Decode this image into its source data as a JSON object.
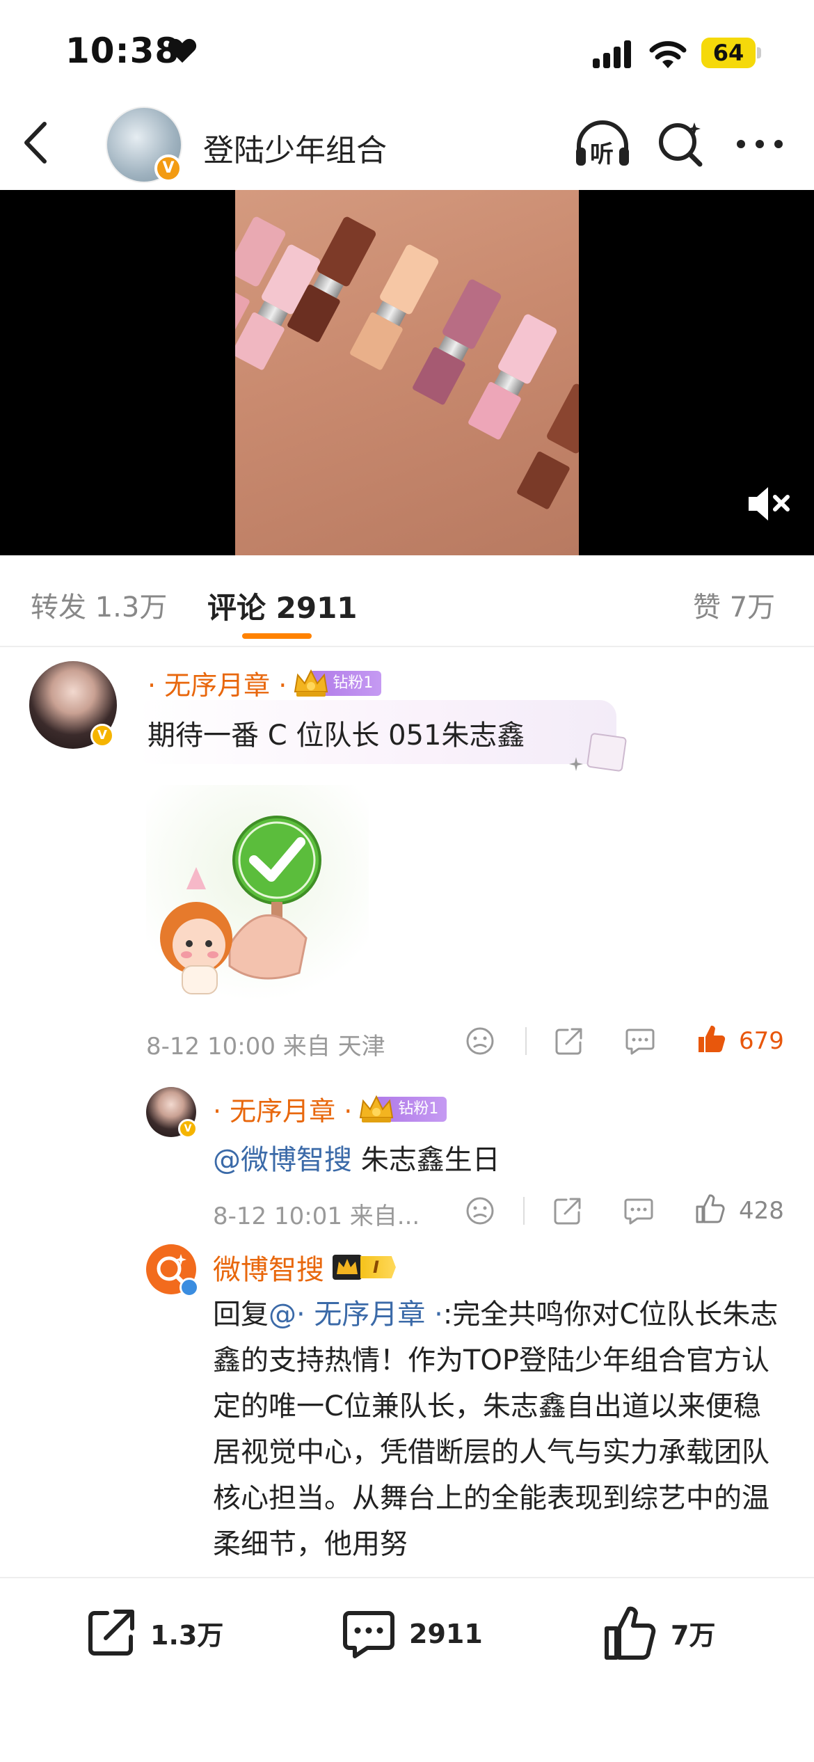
{
  "status_bar": {
    "time": "10:38",
    "battery": "64"
  },
  "header": {
    "title": "登陆少年组合",
    "listen_label": "听"
  },
  "tabs": {
    "repost": "转发 1.3万",
    "comments": "评论 2911",
    "likes": "赞 7万"
  },
  "comments": [
    {
      "name": "· 无序月章 ·",
      "fan_badge": "钻粉1",
      "text": "期待一番 C 位队长 051朱志鑫",
      "meta": "8-12 10:00 来自 天津",
      "likes": "679"
    }
  ],
  "replies": [
    {
      "name": "· 无序月章 ·",
      "fan_badge": "钻粉1",
      "mention": "@微博智搜",
      "text": " 朱志鑫生日",
      "meta": "8-12 10:01 来自...",
      "likes": "428"
    },
    {
      "name": "微博智搜",
      "level_badge": "I",
      "prefix": "回复",
      "mention": "@· 无序月章 ·",
      "text": ":完全共鸣你对C位队长朱志鑫的支持热情！作为TOP登陆少年组合官方认定的唯一C位兼队长，朱志鑫自出道以来便稳居视觉中心，凭借断层的人气与实力承载团队核心担当。从舞台上的全能表现到综艺中的温柔细节，他用努"
    }
  ],
  "bottom_bar": {
    "repost": "1.3万",
    "comments": "2911",
    "likes": "7万"
  },
  "colors": {
    "accent": "#ff8200",
    "name": "#e8670c",
    "mention": "#3b6aa8",
    "like_active": "#e8570c"
  },
  "icons": [
    "heart-icon",
    "signal-icon",
    "wifi-icon",
    "back-icon",
    "headphones-icon",
    "ai-search-icon",
    "more-icon",
    "mute-icon",
    "emoji-icon",
    "share-icon",
    "comment-icon",
    "thumb-up-icon"
  ]
}
